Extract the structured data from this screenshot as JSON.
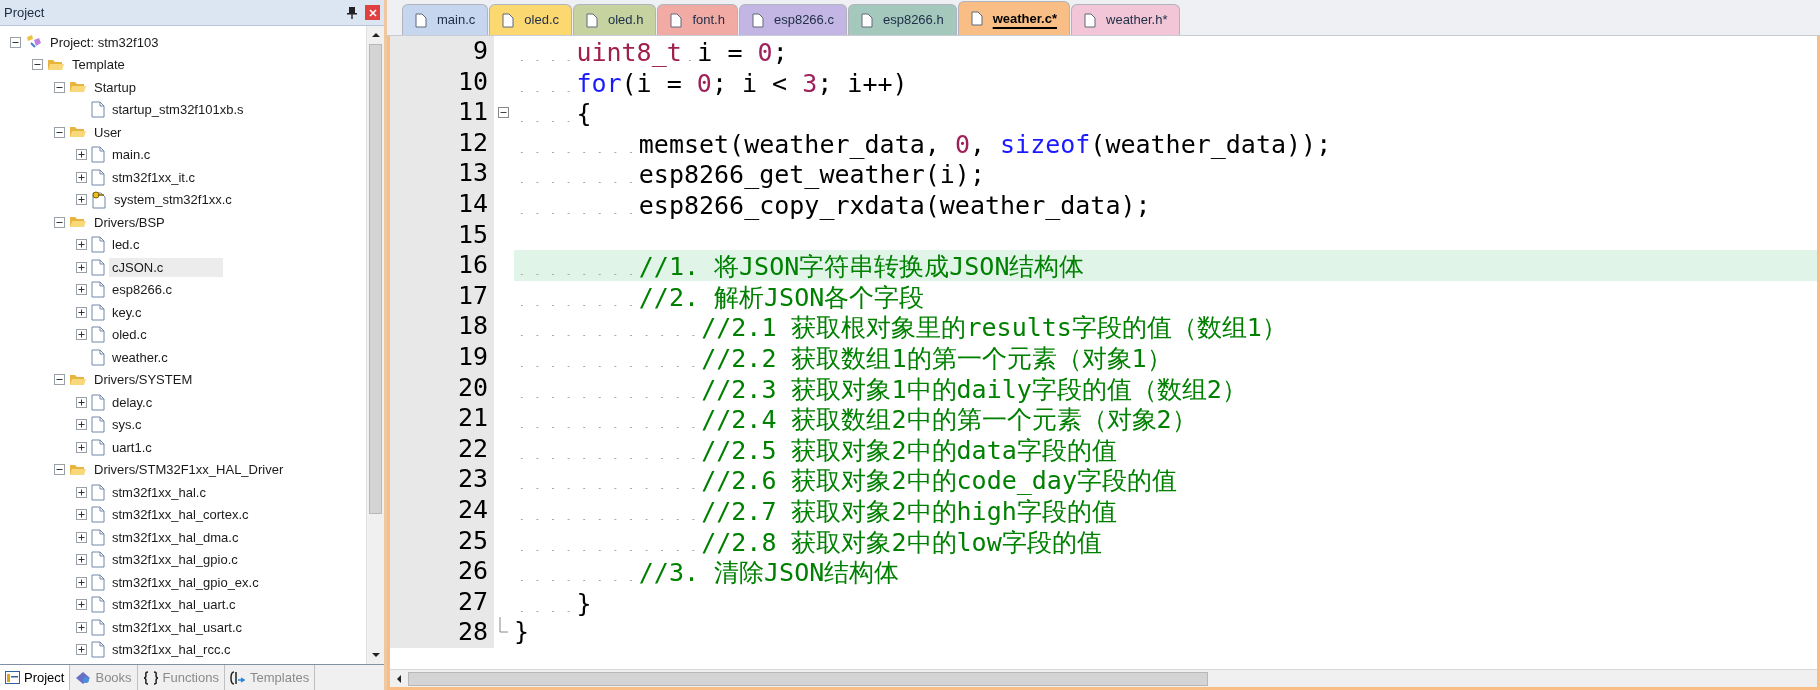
{
  "project_panel": {
    "title": "Project",
    "tree": [
      {
        "label": "Project: stm32f103",
        "kind": "project",
        "expanded": true,
        "children": [
          {
            "label": "Template",
            "kind": "target",
            "expanded": true,
            "children": [
              {
                "label": "Startup",
                "kind": "group",
                "expanded": true,
                "children": [
                  {
                    "label": "startup_stm32f101xb.s",
                    "kind": "leaf",
                    "selected": false
                  }
                ]
              },
              {
                "label": "User",
                "kind": "group",
                "expanded": true,
                "children": [
                  {
                    "label": "main.c",
                    "kind": "file",
                    "expanded": false,
                    "selected": false
                  },
                  {
                    "label": "stm32f1xx_it.c",
                    "kind": "file",
                    "expanded": false,
                    "selected": false
                  },
                  {
                    "label": "system_stm32f1xx.c",
                    "kind": "config",
                    "expanded": false,
                    "selected": false
                  }
                ]
              },
              {
                "label": "Drivers/BSP",
                "kind": "group",
                "expanded": true,
                "children": [
                  {
                    "label": "led.c",
                    "kind": "file",
                    "expanded": false,
                    "selected": false
                  },
                  {
                    "label": "cJSON.c",
                    "kind": "file",
                    "expanded": false,
                    "selected": true
                  },
                  {
                    "label": "esp8266.c",
                    "kind": "file",
                    "expanded": false,
                    "selected": false
                  },
                  {
                    "label": "key.c",
                    "kind": "file",
                    "expanded": false,
                    "selected": false
                  },
                  {
                    "label": "oled.c",
                    "kind": "file",
                    "expanded": false,
                    "selected": false
                  },
                  {
                    "label": "weather.c",
                    "kind": "leaf",
                    "selected": false
                  }
                ]
              },
              {
                "label": "Drivers/SYSTEM",
                "kind": "group",
                "expanded": true,
                "children": [
                  {
                    "label": "delay.c",
                    "kind": "file",
                    "expanded": false,
                    "selected": false
                  },
                  {
                    "label": "sys.c",
                    "kind": "file",
                    "expanded": false,
                    "selected": false
                  },
                  {
                    "label": "uart1.c",
                    "kind": "file",
                    "expanded": false,
                    "selected": false
                  }
                ]
              },
              {
                "label": "Drivers/STM32F1xx_HAL_Driver",
                "kind": "group",
                "expanded": true,
                "children": [
                  {
                    "label": "stm32f1xx_hal.c",
                    "kind": "file",
                    "expanded": false,
                    "selected": false
                  },
                  {
                    "label": "stm32f1xx_hal_cortex.c",
                    "kind": "file",
                    "expanded": false,
                    "selected": false
                  },
                  {
                    "label": "stm32f1xx_hal_dma.c",
                    "kind": "file",
                    "expanded": false,
                    "selected": false
                  },
                  {
                    "label": "stm32f1xx_hal_gpio.c",
                    "kind": "file",
                    "expanded": false,
                    "selected": false
                  },
                  {
                    "label": "stm32f1xx_hal_gpio_ex.c",
                    "kind": "file",
                    "expanded": false,
                    "selected": false
                  },
                  {
                    "label": "stm32f1xx_hal_uart.c",
                    "kind": "file",
                    "expanded": false,
                    "selected": false
                  },
                  {
                    "label": "stm32f1xx_hal_usart.c",
                    "kind": "file",
                    "expanded": false,
                    "selected": false
                  },
                  {
                    "label": "stm32f1xx_hal_rcc.c",
                    "kind": "file",
                    "expanded": false,
                    "selected": false
                  }
                ]
              }
            ]
          }
        ]
      }
    ],
    "bottom_tabs": [
      {
        "label": "Project",
        "kind": "project",
        "selected": true
      },
      {
        "label": "Books",
        "kind": "books",
        "selected": false
      },
      {
        "label": "Functions",
        "kind": "functions",
        "selected": false
      },
      {
        "label": "Templates",
        "kind": "templates",
        "selected": false
      }
    ]
  },
  "editor": {
    "tabs": [
      {
        "label": "main.c",
        "color": "#c6d6ee",
        "selected": false
      },
      {
        "label": "oled.c",
        "color": "#fcd870",
        "selected": false
      },
      {
        "label": "oled.h",
        "color": "#c6d3a0",
        "selected": false
      },
      {
        "label": "font.h",
        "color": "#f2aaa4",
        "selected": false
      },
      {
        "label": "esp8266.c",
        "color": "#c4b6e4",
        "selected": false
      },
      {
        "label": "esp8266.h",
        "color": "#a4c8bc",
        "selected": false
      },
      {
        "label": "weather.c*",
        "color": "#f8be86",
        "selected": true
      },
      {
        "label": "weather.h*",
        "color": "#f2c6d6",
        "selected": false
      }
    ],
    "lines": [
      {
        "number": "9",
        "highlighted": false,
        "tokens": [
          {
            "text": "    uint8_t",
            "kind": "type"
          },
          {
            "text": " i = ",
            "kind": "plain"
          },
          {
            "text": "0",
            "kind": "number"
          },
          {
            "text": ";",
            "kind": "plain"
          }
        ]
      },
      {
        "number": "10",
        "highlighted": false,
        "tokens": [
          {
            "text": "    for",
            "kind": "keyword"
          },
          {
            "text": "(i = ",
            "kind": "plain"
          },
          {
            "text": "0",
            "kind": "number"
          },
          {
            "text": "; i < ",
            "kind": "plain"
          },
          {
            "text": "3",
            "kind": "number"
          },
          {
            "text": "; i++)",
            "kind": "plain"
          }
        ]
      },
      {
        "number": "11",
        "highlighted": false,
        "kind": "fold_start",
        "tokens": [
          {
            "text": "    {",
            "kind": "plain"
          }
        ]
      },
      {
        "number": "12",
        "highlighted": false,
        "tokens": [
          {
            "text": "        memset(weather_data, ",
            "kind": "plain"
          },
          {
            "text": "0",
            "kind": "number"
          },
          {
            "text": ", ",
            "kind": "plain"
          },
          {
            "text": "sizeof",
            "kind": "keyword"
          },
          {
            "text": "(weather_data));",
            "kind": "plain"
          }
        ]
      },
      {
        "number": "13",
        "highlighted": false,
        "tokens": [
          {
            "text": "        esp8266_get_weather(i);",
            "kind": "plain"
          }
        ]
      },
      {
        "number": "14",
        "highlighted": false,
        "tokens": [
          {
            "text": "        esp8266_copy_rxdata(weather_data);",
            "kind": "plain"
          }
        ]
      },
      {
        "number": "15",
        "highlighted": false
      },
      {
        "number": "16",
        "highlighted": true,
        "tokens": [
          {
            "text": "        //1. 将JSON字符串转换成JSON结构体",
            "kind": "comment"
          }
        ]
      },
      {
        "number": "17",
        "highlighted": false,
        "tokens": [
          {
            "text": "        //2. 解析JSON各个字段",
            "kind": "comment"
          }
        ]
      },
      {
        "number": "18",
        "highlighted": false,
        "tokens": [
          {
            "text": "            //2.1 获取根对象里的results字段的值（数组1）",
            "kind": "comment"
          }
        ]
      },
      {
        "number": "19",
        "highlighted": false,
        "tokens": [
          {
            "text": "            //2.2 获取数组1的第一个元素（对象1）",
            "kind": "comment"
          }
        ]
      },
      {
        "number": "20",
        "highlighted": false,
        "tokens": [
          {
            "text": "            //2.3 获取对象1中的daily字段的值（数组2）",
            "kind": "comment"
          }
        ]
      },
      {
        "number": "21",
        "highlighted": false,
        "tokens": [
          {
            "text": "            //2.4 获取数组2中的第一个元素（对象2）",
            "kind": "comment"
          }
        ]
      },
      {
        "number": "22",
        "highlighted": false,
        "tokens": [
          {
            "text": "            //2.5 获取对象2中的data字段的值",
            "kind": "comment"
          }
        ]
      },
      {
        "number": "23",
        "highlighted": false,
        "tokens": [
          {
            "text": "            //2.6 获取对象2中的code_day字段的值",
            "kind": "comment"
          }
        ]
      },
      {
        "number": "24",
        "highlighted": false,
        "tokens": [
          {
            "text": "            //2.7 获取对象2中的high字段的值",
            "kind": "comment"
          }
        ]
      },
      {
        "number": "25",
        "highlighted": false,
        "tokens": [
          {
            "text": "            //2.8 获取对象2中的low字段的值",
            "kind": "comment"
          }
        ]
      },
      {
        "number": "26",
        "highlighted": false,
        "tokens": [
          {
            "text": "        //3. 清除JSON结构体",
            "kind": "comment"
          }
        ]
      },
      {
        "number": "27",
        "highlighted": false,
        "tokens": [
          {
            "text": "    }",
            "kind": "plain"
          }
        ]
      },
      {
        "number": "28",
        "highlighted": false,
        "kind": "fold_end",
        "tokens": [
          {
            "text": "}",
            "kind": "plain"
          }
        ]
      }
    ]
  }
}
